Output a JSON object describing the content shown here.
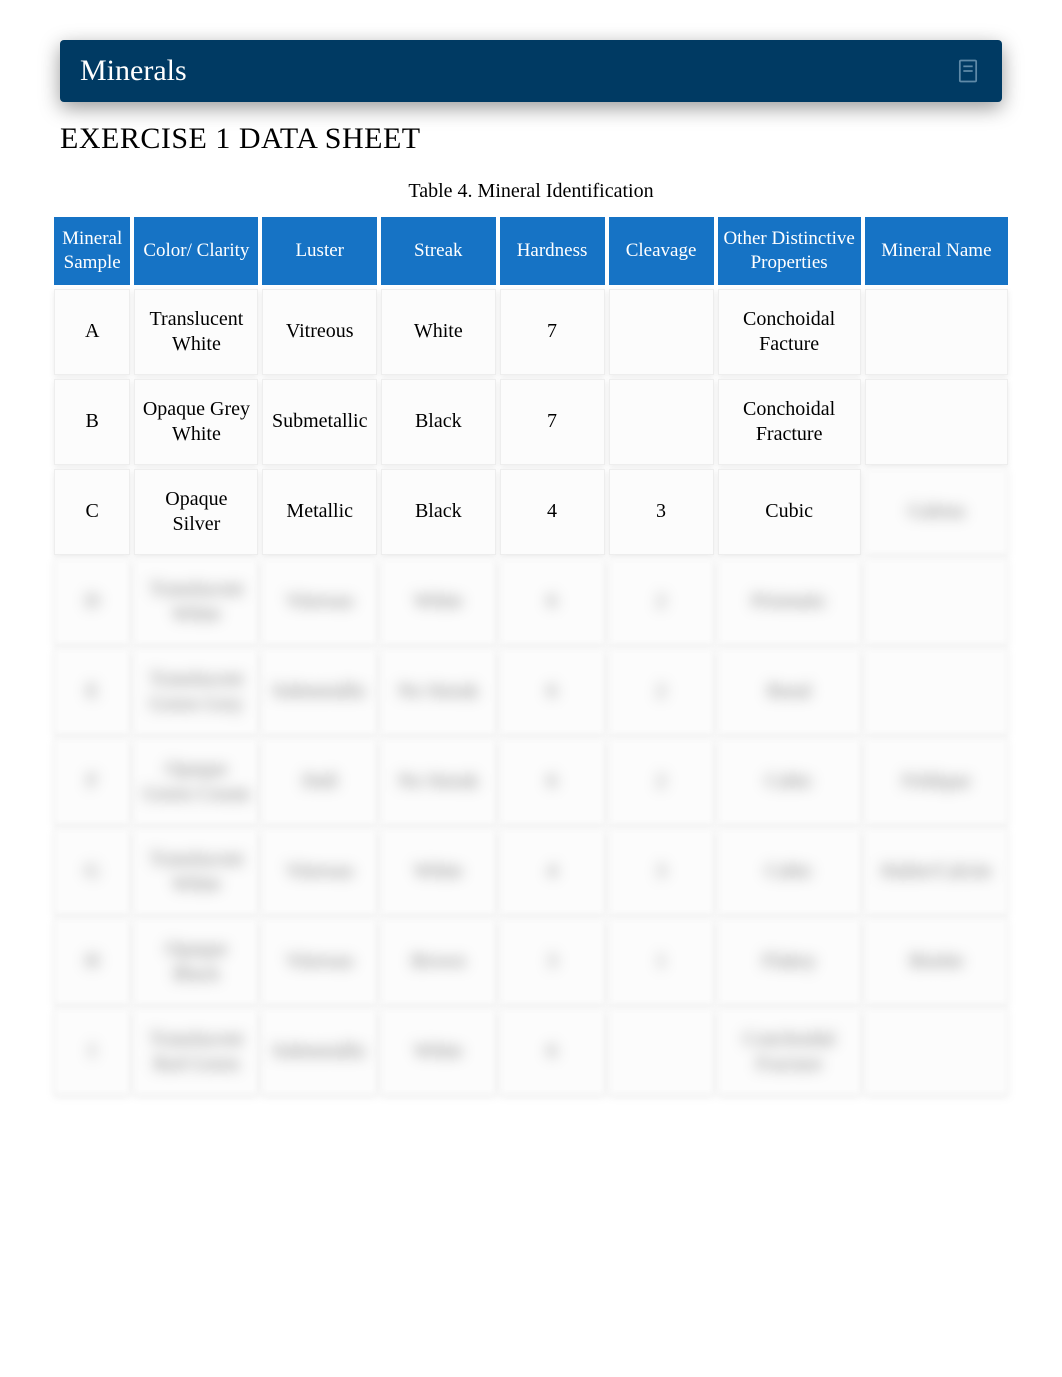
{
  "banner": {
    "title": "Minerals"
  },
  "page_title": "EXERCISE 1 DATA SHEET",
  "table_caption": "Table 4. Mineral Identification",
  "columns": [
    "Mineral Sample",
    "Color/ Clarity",
    "Luster",
    "Streak",
    "Hardness",
    "Cleavage",
    "Other Distinctive Properties",
    "Mineral Name"
  ],
  "rows": [
    {
      "sample": "A",
      "color": "Translucent White",
      "luster": "Vitreous",
      "streak": "White",
      "hardness": "7",
      "cleavage": "",
      "other": "Conchoidal Facture",
      "name": "",
      "blurred": [
        false,
        false,
        false,
        false,
        false,
        false,
        false,
        false
      ]
    },
    {
      "sample": "B",
      "color": "Opaque Grey White",
      "luster": "Submetallic",
      "streak": "Black",
      "hardness": "7",
      "cleavage": "",
      "other": "Conchoidal Fracture",
      "name": "",
      "blurred": [
        false,
        false,
        false,
        false,
        false,
        false,
        false,
        false
      ]
    },
    {
      "sample": "C",
      "color": "Opaque Silver",
      "luster": "Metallic",
      "streak": "Black",
      "hardness": "4",
      "cleavage": "3",
      "other": "Cubic",
      "name": "Galena",
      "blurred": [
        false,
        false,
        false,
        false,
        false,
        false,
        false,
        true
      ]
    },
    {
      "sample": "D",
      "color": "Translucent White",
      "luster": "Vitreous",
      "streak": "White",
      "hardness": "6",
      "cleavage": "2",
      "other": "Prismatic",
      "name": "",
      "blurred": [
        true,
        true,
        true,
        true,
        true,
        true,
        true,
        true
      ]
    },
    {
      "sample": "E",
      "color": "Translucent Green Grey",
      "luster": "Submetallic",
      "streak": "No Streak",
      "hardness": "6",
      "cleavage": "2",
      "other": "Basal",
      "name": "",
      "blurred": [
        true,
        true,
        true,
        true,
        true,
        true,
        true,
        true
      ]
    },
    {
      "sample": "F",
      "color": "Opaque Green Cream",
      "luster": "Dull",
      "streak": "No Streak",
      "hardness": "6",
      "cleavage": "2",
      "other": "Cubic",
      "name": "Feldspar",
      "blurred": [
        true,
        true,
        true,
        true,
        true,
        true,
        true,
        true
      ]
    },
    {
      "sample": "G",
      "color": "Translucent White",
      "luster": "Vitreous",
      "streak": "White",
      "hardness": "4",
      "cleavage": "3",
      "other": "Cubic",
      "name": "Halite/Calcite",
      "blurred": [
        true,
        true,
        true,
        true,
        true,
        true,
        true,
        true
      ]
    },
    {
      "sample": "H",
      "color": "Opaque Black",
      "luster": "Vitreous",
      "streak": "Brown",
      "hardness": "3",
      "cleavage": "1",
      "other": "Flakey",
      "name": "Biotite",
      "blurred": [
        true,
        true,
        true,
        true,
        true,
        true,
        true,
        true
      ]
    },
    {
      "sample": "I",
      "color": "Translucent Red Green",
      "luster": "Submetallic",
      "streak": "White",
      "hardness": "6",
      "cleavage": "",
      "other": "Conchoidal Fracture",
      "name": "",
      "blurred": [
        true,
        true,
        true,
        true,
        true,
        true,
        true,
        true
      ]
    }
  ]
}
